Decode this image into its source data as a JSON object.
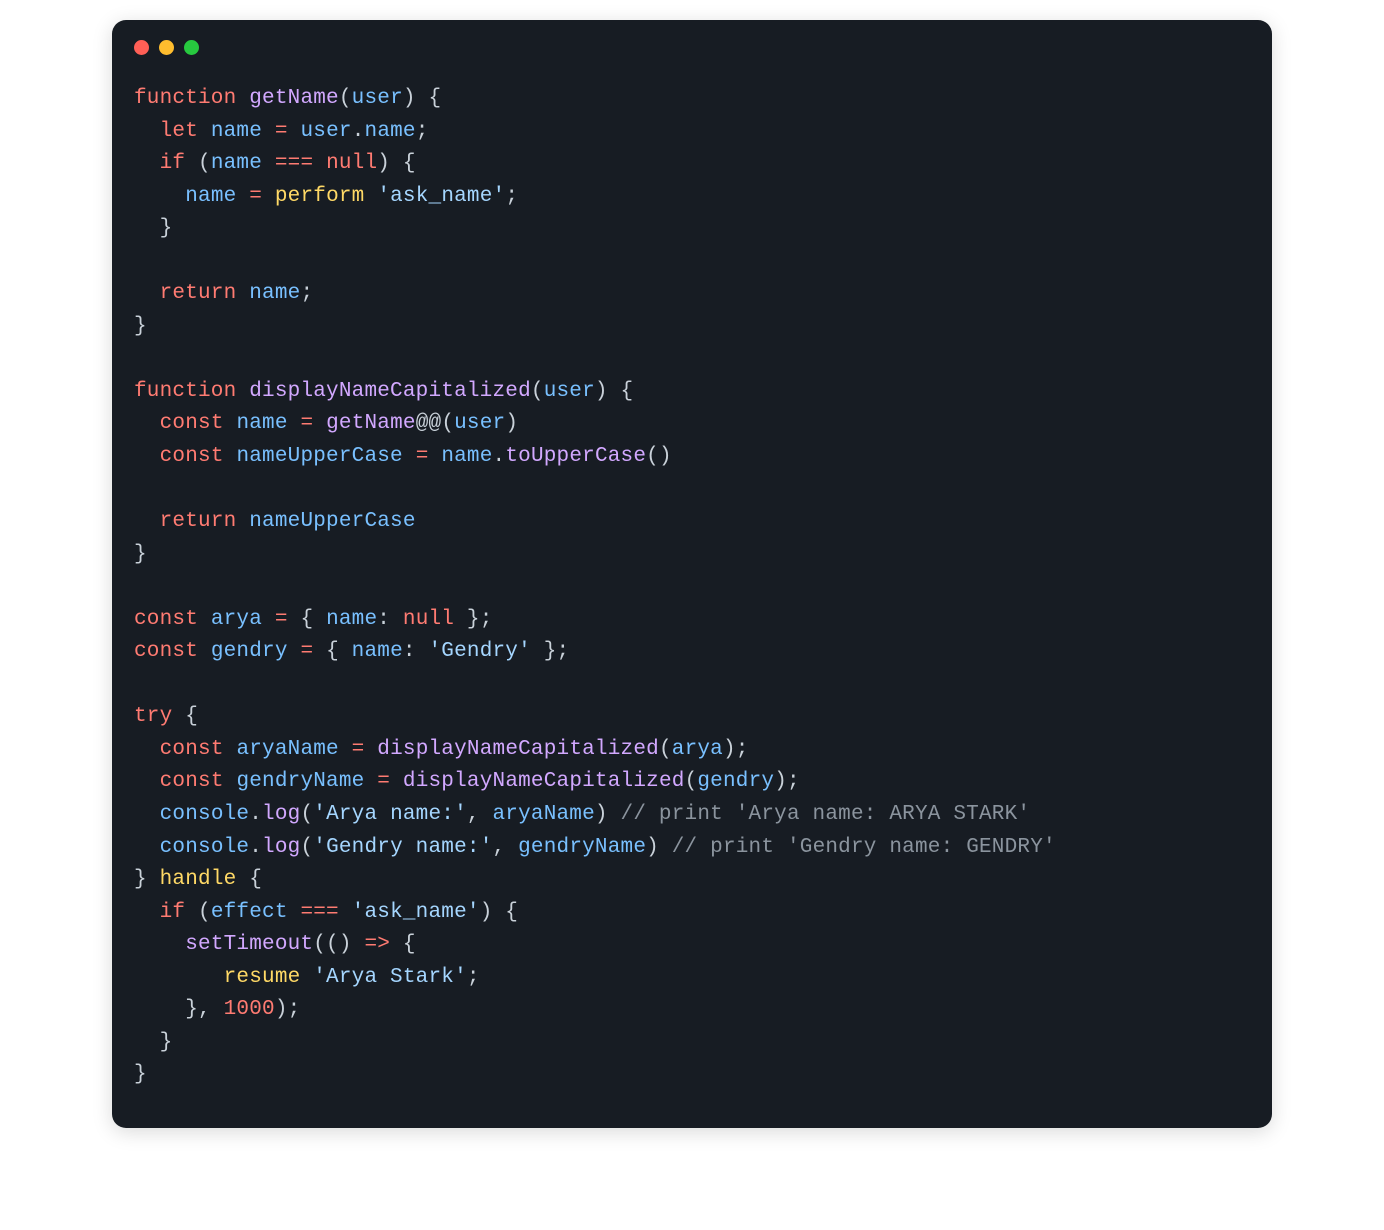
{
  "window": {
    "traffic_lights": [
      "close",
      "minimize",
      "zoom"
    ]
  },
  "code": {
    "tokens": [
      [
        [
          "kw",
          "function"
        ],
        [
          "pun",
          " "
        ],
        [
          "fn",
          "getName"
        ],
        [
          "pun",
          "("
        ],
        [
          "var",
          "user"
        ],
        [
          "pun",
          ") {"
        ]
      ],
      [
        [
          "pun",
          "  "
        ],
        [
          "kw",
          "let"
        ],
        [
          "pun",
          " "
        ],
        [
          "var",
          "name"
        ],
        [
          "pun",
          " "
        ],
        [
          "op",
          "="
        ],
        [
          "pun",
          " "
        ],
        [
          "var",
          "user"
        ],
        [
          "pun",
          "."
        ],
        [
          "prop",
          "name"
        ],
        [
          "pun",
          ";"
        ]
      ],
      [
        [
          "pun",
          "  "
        ],
        [
          "kw",
          "if"
        ],
        [
          "pun",
          " ("
        ],
        [
          "var",
          "name"
        ],
        [
          "pun",
          " "
        ],
        [
          "op",
          "==="
        ],
        [
          "pun",
          " "
        ],
        [
          "null",
          "null"
        ],
        [
          "pun",
          ") {"
        ]
      ],
      [
        [
          "pun",
          "    "
        ],
        [
          "var",
          "name"
        ],
        [
          "pun",
          " "
        ],
        [
          "op",
          "="
        ],
        [
          "pun",
          " "
        ],
        [
          "eff",
          "perform"
        ],
        [
          "pun",
          " "
        ],
        [
          "str",
          "'ask_name'"
        ],
        [
          "pun",
          ";"
        ]
      ],
      [
        [
          "pun",
          "  }"
        ]
      ],
      [
        [
          "pun",
          ""
        ]
      ],
      [
        [
          "pun",
          "  "
        ],
        [
          "kw",
          "return"
        ],
        [
          "pun",
          " "
        ],
        [
          "var",
          "name"
        ],
        [
          "pun",
          ";"
        ]
      ],
      [
        [
          "pun",
          "}"
        ]
      ],
      [
        [
          "pun",
          ""
        ]
      ],
      [
        [
          "kw",
          "function"
        ],
        [
          "pun",
          " "
        ],
        [
          "fn",
          "displayNameCapitalized"
        ],
        [
          "pun",
          "("
        ],
        [
          "var",
          "user"
        ],
        [
          "pun",
          ") {"
        ]
      ],
      [
        [
          "pun",
          "  "
        ],
        [
          "kw",
          "const"
        ],
        [
          "pun",
          " "
        ],
        [
          "var",
          "name"
        ],
        [
          "pun",
          " "
        ],
        [
          "op",
          "="
        ],
        [
          "pun",
          " "
        ],
        [
          "call",
          "getName"
        ],
        [
          "pun",
          "@@("
        ],
        [
          "var",
          "user"
        ],
        [
          "pun",
          ")"
        ]
      ],
      [
        [
          "pun",
          "  "
        ],
        [
          "kw",
          "const"
        ],
        [
          "pun",
          " "
        ],
        [
          "var",
          "nameUpperCase"
        ],
        [
          "pun",
          " "
        ],
        [
          "op",
          "="
        ],
        [
          "pun",
          " "
        ],
        [
          "var",
          "name"
        ],
        [
          "pun",
          "."
        ],
        [
          "call",
          "toUpperCase"
        ],
        [
          "pun",
          "()"
        ]
      ],
      [
        [
          "pun",
          ""
        ]
      ],
      [
        [
          "pun",
          "  "
        ],
        [
          "kw",
          "return"
        ],
        [
          "pun",
          " "
        ],
        [
          "var",
          "nameUpperCase"
        ]
      ],
      [
        [
          "pun",
          "}"
        ]
      ],
      [
        [
          "pun",
          ""
        ]
      ],
      [
        [
          "kw",
          "const"
        ],
        [
          "pun",
          " "
        ],
        [
          "var",
          "arya"
        ],
        [
          "pun",
          " "
        ],
        [
          "op",
          "="
        ],
        [
          "pun",
          " { "
        ],
        [
          "prop",
          "name"
        ],
        [
          "pun",
          ": "
        ],
        [
          "null",
          "null"
        ],
        [
          "pun",
          " };"
        ]
      ],
      [
        [
          "kw",
          "const"
        ],
        [
          "pun",
          " "
        ],
        [
          "var",
          "gendry"
        ],
        [
          "pun",
          " "
        ],
        [
          "op",
          "="
        ],
        [
          "pun",
          " { "
        ],
        [
          "prop",
          "name"
        ],
        [
          "pun",
          ": "
        ],
        [
          "str",
          "'Gendry'"
        ],
        [
          "pun",
          " };"
        ]
      ],
      [
        [
          "pun",
          ""
        ]
      ],
      [
        [
          "kw",
          "try"
        ],
        [
          "pun",
          " {"
        ]
      ],
      [
        [
          "pun",
          "  "
        ],
        [
          "kw",
          "const"
        ],
        [
          "pun",
          " "
        ],
        [
          "var",
          "aryaName"
        ],
        [
          "pun",
          " "
        ],
        [
          "op",
          "="
        ],
        [
          "pun",
          " "
        ],
        [
          "call",
          "displayNameCapitalized"
        ],
        [
          "pun",
          "("
        ],
        [
          "var",
          "arya"
        ],
        [
          "pun",
          ");"
        ]
      ],
      [
        [
          "pun",
          "  "
        ],
        [
          "kw",
          "const"
        ],
        [
          "pun",
          " "
        ],
        [
          "var",
          "gendryName"
        ],
        [
          "pun",
          " "
        ],
        [
          "op",
          "="
        ],
        [
          "pun",
          " "
        ],
        [
          "call",
          "displayNameCapitalized"
        ],
        [
          "pun",
          "("
        ],
        [
          "var",
          "gendry"
        ],
        [
          "pun",
          ");"
        ]
      ],
      [
        [
          "pun",
          "  "
        ],
        [
          "var",
          "console"
        ],
        [
          "pun",
          "."
        ],
        [
          "call",
          "log"
        ],
        [
          "pun",
          "("
        ],
        [
          "str",
          "'Arya name:'"
        ],
        [
          "pun",
          ", "
        ],
        [
          "var",
          "aryaName"
        ],
        [
          "pun",
          ") "
        ],
        [
          "com",
          "// print 'Arya name: ARYA STARK'"
        ]
      ],
      [
        [
          "pun",
          "  "
        ],
        [
          "var",
          "console"
        ],
        [
          "pun",
          "."
        ],
        [
          "call",
          "log"
        ],
        [
          "pun",
          "("
        ],
        [
          "str",
          "'Gendry name:'"
        ],
        [
          "pun",
          ", "
        ],
        [
          "var",
          "gendryName"
        ],
        [
          "pun",
          ") "
        ],
        [
          "com",
          "// print 'Gendry name: GENDRY'"
        ]
      ],
      [
        [
          "pun",
          "} "
        ],
        [
          "eff",
          "handle"
        ],
        [
          "pun",
          " {"
        ]
      ],
      [
        [
          "pun",
          "  "
        ],
        [
          "kw",
          "if"
        ],
        [
          "pun",
          " ("
        ],
        [
          "var",
          "effect"
        ],
        [
          "pun",
          " "
        ],
        [
          "op",
          "==="
        ],
        [
          "pun",
          " "
        ],
        [
          "str",
          "'ask_name'"
        ],
        [
          "pun",
          ") {"
        ]
      ],
      [
        [
          "pun",
          "    "
        ],
        [
          "call",
          "setTimeout"
        ],
        [
          "pun",
          "(() "
        ],
        [
          "op",
          "=>"
        ],
        [
          "pun",
          " {"
        ]
      ],
      [
        [
          "pun",
          "       "
        ],
        [
          "eff",
          "resume"
        ],
        [
          "pun",
          " "
        ],
        [
          "str",
          "'Arya Stark'"
        ],
        [
          "pun",
          ";"
        ]
      ],
      [
        [
          "pun",
          "    }, "
        ],
        [
          "num",
          "1000"
        ],
        [
          "pun",
          ");"
        ]
      ],
      [
        [
          "pun",
          "  }"
        ]
      ],
      [
        [
          "pun",
          "}"
        ]
      ]
    ]
  }
}
